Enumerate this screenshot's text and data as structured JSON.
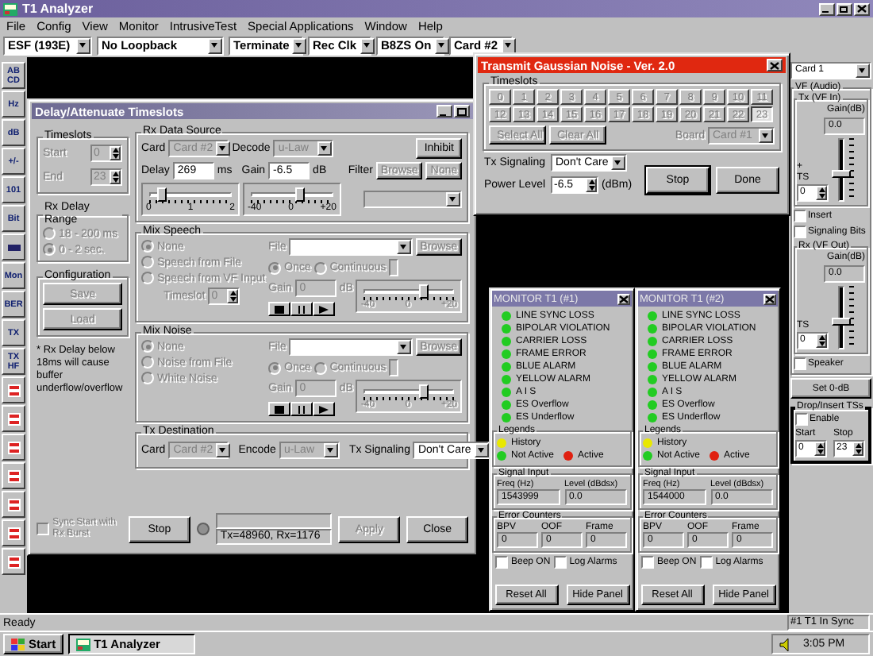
{
  "app": {
    "title": "T1 Analyzer",
    "menu": [
      "File",
      "Config",
      "View",
      "Monitor",
      "IntrusiveTest",
      "Special Applications",
      "Window",
      "Help"
    ],
    "toolbar": [
      "ESF (193E)",
      "No Loopback",
      "Terminate",
      "Rec Clk",
      "B8ZS On",
      "Card #2"
    ],
    "tools": [
      {
        "kind": "text",
        "label": "AB CD"
      },
      {
        "kind": "text",
        "label": "Hz"
      },
      {
        "kind": "text",
        "label": "dB"
      },
      {
        "kind": "text",
        "label": "+/-"
      },
      {
        "kind": "text",
        "label": "101"
      },
      {
        "kind": "text",
        "label": "Bit"
      },
      {
        "kind": "icon"
      },
      {
        "kind": "text",
        "label": "Mon"
      },
      {
        "kind": "text",
        "label": "BER"
      },
      {
        "kind": "text",
        "label": "TX"
      },
      {
        "kind": "text",
        "label": "TX HF"
      },
      {
        "kind": "red"
      },
      {
        "kind": "red"
      },
      {
        "kind": "red"
      },
      {
        "kind": "red"
      },
      {
        "kind": "red"
      },
      {
        "kind": "red"
      },
      {
        "kind": "red"
      }
    ],
    "status": "Ready",
    "sync_status": "#1 T1 In Sync"
  },
  "delay_window": {
    "title": "Delay/Attenuate Timeslots",
    "timeslots": {
      "title": "Timeslots",
      "disabled": true,
      "start_label": "Start",
      "start": "0",
      "end_label": "End",
      "end": "23"
    },
    "delay_range": {
      "title": "Rx Delay Range",
      "disabled": true,
      "options": [
        {
          "label": "18 - 200 ms",
          "selected": false
        },
        {
          "label": "0 - 2 sec.",
          "selected": true
        }
      ]
    },
    "configuration": {
      "title": "Configuration",
      "disabled": true,
      "buttons": [
        "Save",
        "Load"
      ]
    },
    "note": "* Rx Delay below 18ms will cause buffer underflow/overflow",
    "rx_source": {
      "title": "Rx Data Source",
      "card": {
        "label": "Card",
        "value": "Card #2",
        "disabled": true
      },
      "decode": {
        "label": "Decode",
        "value": "u-Law",
        "disabled": true
      },
      "inhibit": {
        "label": "Inhibit",
        "disabled": false
      },
      "delay_label": "Delay",
      "delay": "269",
      "delay_unit": "ms",
      "gain_label": "Gain",
      "gain": "-6.5",
      "gain_unit": "dB",
      "filter_label": "Filter",
      "filter_buttons": [
        {
          "label": "Browse",
          "disabled": true
        },
        {
          "label": "None",
          "disabled": true
        }
      ],
      "delay_slider": {
        "level": 0.13,
        "ticks": [
          "0",
          "1",
          "2"
        ]
      },
      "gain_slider": {
        "level": 0.6,
        "ticks": [
          "-40",
          "0",
          "+20"
        ]
      }
    },
    "mix_speech": {
      "title": "Mix Speech",
      "disabled": true,
      "options": [
        {
          "label": "None",
          "selected": true
        },
        {
          "label": "Speech from File",
          "selected": false
        },
        {
          "label": "Speech from VF Input",
          "selected": false
        }
      ],
      "file_label": "File",
      "browse": "Browse",
      "modes": [
        {
          "label": "Once",
          "selected": true
        },
        {
          "label": "Continuous",
          "selected": false
        }
      ],
      "gain_label": "Gain",
      "gain": "0",
      "gain_unit": "dB",
      "timeslot_label": "Timeslot",
      "timeslot": "0",
      "slider": {
        "level": 0.67,
        "ticks": [
          "-40",
          "0",
          "+20"
        ]
      }
    },
    "mix_noise": {
      "title": "Mix Noise",
      "disabled": true,
      "options": [
        {
          "label": "None",
          "selected": true
        },
        {
          "label": "Noise from File",
          "selected": false
        },
        {
          "label": "White Noise",
          "selected": false
        }
      ],
      "file_label": "File",
      "browse": "Browse",
      "modes": [
        {
          "label": "Once",
          "selected": true
        },
        {
          "label": "Continuous",
          "selected": false
        }
      ],
      "gain_label": "Gain",
      "gain": "0",
      "gain_unit": "dB",
      "slider": {
        "level": 0.67,
        "ticks": [
          "-40",
          "0",
          "+20"
        ]
      }
    },
    "tx_destination": {
      "title": "Tx Destination",
      "card": {
        "label": "Card",
        "value": "Card #2",
        "disabled": true
      },
      "encode": {
        "label": "Encode",
        "value": "u-Law",
        "disabled": true
      },
      "signaling": {
        "label": "Tx Signaling",
        "value": "Don't Care",
        "disabled": false
      }
    },
    "sync_start": {
      "label": "Sync Start with Rx Burst",
      "checked": false,
      "disabled": true
    },
    "stop": {
      "label": "Stop",
      "disabled": false
    },
    "counts": "Tx=48960, Rx=1176",
    "apply": {
      "label": "Apply",
      "disabled": true
    },
    "close": {
      "label": "Close",
      "disabled": false
    }
  },
  "gaussian_window": {
    "title": "Transmit Gaussian Noise - Ver. 2.0",
    "timeslots_title": "Timeslots",
    "disabled": true,
    "slots": [
      {
        "label": "0",
        "selected": false
      },
      {
        "label": "1",
        "selected": false
      },
      {
        "label": "2",
        "selected": false
      },
      {
        "label": "3",
        "selected": false
      },
      {
        "label": "4",
        "selected": false
      },
      {
        "label": "5",
        "selected": false
      },
      {
        "label": "6",
        "selected": false
      },
      {
        "label": "7",
        "selected": false
      },
      {
        "label": "8",
        "selected": false
      },
      {
        "label": "9",
        "selected": false
      },
      {
        "label": "10",
        "selected": false
      },
      {
        "label": "11",
        "selected": false
      },
      {
        "label": "12",
        "selected": false
      },
      {
        "label": "13",
        "selected": false
      },
      {
        "label": "14",
        "selected": false
      },
      {
        "label": "15",
        "selected": false
      },
      {
        "label": "16",
        "selected": false
      },
      {
        "label": "17",
        "selected": false
      },
      {
        "label": "18",
        "selected": false
      },
      {
        "label": "19",
        "selected": false
      },
      {
        "label": "20",
        "selected": false
      },
      {
        "label": "21",
        "selected": false
      },
      {
        "label": "22",
        "selected": false
      },
      {
        "label": "23",
        "selected": true
      }
    ],
    "select_all": "Select All",
    "clear_all": "Clear All",
    "board": {
      "label": "Board",
      "value": "Card #1",
      "disabled": true
    },
    "signaling": {
      "label": "Tx Signaling",
      "value": "Don't Care",
      "disabled": false
    },
    "power_label": "Power Level",
    "power": "-6.5",
    "power_unit": "(dBm)",
    "stop": "Stop",
    "done": "Done"
  },
  "vf_panel": {
    "card": "Card 1",
    "title": "VF (Audio)",
    "tx": {
      "title": "Tx (VF In)",
      "gain_label": "Gain(dB)",
      "gain": "0.0",
      "plus": "+",
      "ts_label": "TS",
      "ts": "0",
      "level": 0.45
    },
    "insert": {
      "label": "Insert",
      "checked": false
    },
    "signaling_bits": {
      "label": "Signaling Bits",
      "checked": false
    },
    "rx": {
      "title": "Rx (VF Out)",
      "gain_label": "Gain(dB)",
      "gain": "0.0",
      "ts_label": "TS",
      "ts": "0",
      "level": 0.45
    },
    "speaker": {
      "label": "Speaker",
      "checked": false
    },
    "set_button": "Set 0-dB"
  },
  "drop_insert": {
    "title": "Drop/Insert TSs",
    "enable": {
      "label": "Enable",
      "checked": false
    },
    "start_label": "Start",
    "stop_label": "Stop",
    "start": "0",
    "stop": "23"
  },
  "monitors": [
    {
      "title": "MONITOR T1 (#1)",
      "alarms": [
        {
          "label": "LINE SYNC LOSS",
          "color": "#22cc22"
        },
        {
          "label": "BIPOLAR VIOLATION",
          "color": "#22cc22"
        },
        {
          "label": "CARRIER LOSS",
          "color": "#22cc22"
        },
        {
          "label": "FRAME ERROR",
          "color": "#22cc22"
        },
        {
          "label": "BLUE ALARM",
          "color": "#22cc22"
        },
        {
          "label": "YELLOW ALARM",
          "color": "#22cc22"
        },
        {
          "label": "A I S",
          "color": "#22cc22"
        },
        {
          "label": "ES Overflow",
          "color": "#22cc22"
        },
        {
          "label": "ES Underflow",
          "color": "#22cc22"
        }
      ],
      "legends_title": "Legends",
      "legends": [
        {
          "label": "History",
          "color": "#e8e800"
        },
        {
          "label": "Not Active",
          "color": "#22cc22"
        },
        {
          "label": "Active",
          "color": "#e02010"
        }
      ],
      "signal_title": "Signal Input",
      "freq_label": "Freq (Hz)",
      "freq": "1543999",
      "level_label": "Level (dBdsx)",
      "level_value": "0.0",
      "errors_title": "Error Counters",
      "errors": [
        {
          "label": "BPV",
          "value": "0"
        },
        {
          "label": "OOF",
          "value": "0"
        },
        {
          "label": "Frame",
          "value": "0"
        }
      ],
      "beep": {
        "label": "Beep ON",
        "checked": false
      },
      "log": {
        "label": "Log Alarms",
        "checked": false
      },
      "buttons": [
        "Reset All",
        "Hide Panel"
      ]
    },
    {
      "title": "MONITOR T1 (#2)",
      "alarms": [
        {
          "label": "LINE SYNC LOSS",
          "color": "#22cc22"
        },
        {
          "label": "BIPOLAR VIOLATION",
          "color": "#22cc22"
        },
        {
          "label": "CARRIER LOSS",
          "color": "#22cc22"
        },
        {
          "label": "FRAME ERROR",
          "color": "#22cc22"
        },
        {
          "label": "BLUE ALARM",
          "color": "#22cc22"
        },
        {
          "label": "YELLOW ALARM",
          "color": "#22cc22"
        },
        {
          "label": "A I S",
          "color": "#22cc22"
        },
        {
          "label": "ES Overflow",
          "color": "#22cc22"
        },
        {
          "label": "ES Underflow",
          "color": "#22cc22"
        }
      ],
      "legends_title": "Legends",
      "legends": [
        {
          "label": "History",
          "color": "#e8e800"
        },
        {
          "label": "Not Active",
          "color": "#22cc22"
        },
        {
          "label": "Active",
          "color": "#e02010"
        }
      ],
      "signal_title": "Signal Input",
      "freq_label": "Freq (Hz)",
      "freq": "1544000",
      "level_label": "Level (dBdsx)",
      "level_value": "0.0",
      "errors_title": "Error Counters",
      "errors": [
        {
          "label": "BPV",
          "value": "0"
        },
        {
          "label": "OOF",
          "value": "0"
        },
        {
          "label": "Frame",
          "value": "0"
        }
      ],
      "beep": {
        "label": "Beep ON",
        "checked": false
      },
      "log": {
        "label": "Log Alarms",
        "checked": false
      },
      "buttons": [
        "Reset All",
        "Hide Panel"
      ]
    }
  ],
  "taskbar": {
    "start": "Start",
    "task": "T1 Analyzer",
    "clock": "3:05 PM"
  }
}
